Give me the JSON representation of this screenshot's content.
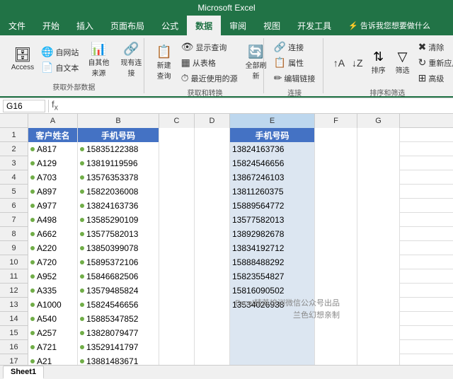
{
  "titleBar": {
    "text": "Microsoft Excel",
    "color": "#217346"
  },
  "ribbon": {
    "tabs": [
      "文件",
      "开始",
      "插入",
      "页面布局",
      "公式",
      "数据",
      "审阅",
      "视图",
      "开发工具",
      "告诉我您想要做什么"
    ],
    "activeTab": "数据",
    "groups": [
      {
        "label": "获取外部数据",
        "buttons": [
          {
            "id": "access",
            "label": "Access",
            "icon": "🗄"
          },
          {
            "id": "web",
            "label": "自网站",
            "icon": "🌐"
          },
          {
            "id": "text",
            "label": "自文本",
            "icon": "📄"
          },
          {
            "id": "other",
            "label": "自其他来源",
            "icon": "📊"
          },
          {
            "id": "existing",
            "label": "现有连接",
            "icon": "🔗"
          }
        ]
      },
      {
        "label": "获取和转换",
        "buttons": [
          {
            "id": "new-query",
            "label": "新建查询",
            "icon": "➕"
          },
          {
            "id": "show-query",
            "label": "显示查询",
            "icon": "👁"
          },
          {
            "id": "from-table",
            "label": "从表格",
            "icon": "▦"
          },
          {
            "id": "recent",
            "label": "最近使用的源",
            "icon": "⏱"
          },
          {
            "id": "refresh-all",
            "label": "全部刷新",
            "icon": "🔄"
          }
        ]
      },
      {
        "label": "连接",
        "buttons": [
          {
            "id": "connections",
            "label": "连接",
            "icon": "🔗"
          },
          {
            "id": "properties",
            "label": "属性",
            "icon": "📋"
          },
          {
            "id": "edit-links",
            "label": "编辑链接",
            "icon": "✏"
          }
        ]
      },
      {
        "label": "排序和筛选",
        "buttons": [
          {
            "id": "sort-asc",
            "label": "",
            "icon": "↑A"
          },
          {
            "id": "sort-desc",
            "label": "",
            "icon": "↓Z"
          },
          {
            "id": "sort",
            "label": "排序",
            "icon": "⇅"
          },
          {
            "id": "filter",
            "label": "筛选",
            "icon": "▽"
          },
          {
            "id": "clear",
            "label": "清除",
            "icon": "✖"
          },
          {
            "id": "reapply",
            "label": "重新应用",
            "icon": "↻"
          },
          {
            "id": "advanced",
            "label": "高级",
            "icon": "⊞"
          }
        ]
      }
    ],
    "accessLabel": "Access",
    "webLabel": "自网站",
    "textLabel": "自文本"
  },
  "formulaBar": {
    "cellRef": "G16",
    "formula": ""
  },
  "columns": [
    "A",
    "B",
    "C",
    "D",
    "E",
    "F",
    "G"
  ],
  "headers": {
    "row1": {
      "A": "客户姓名",
      "B": "手机号码",
      "E": "手机号码"
    }
  },
  "rows": [
    {
      "num": "2",
      "A": "A817",
      "B": "15835122388",
      "E": "13824163736"
    },
    {
      "num": "3",
      "A": "A129",
      "B": "13819119596",
      "E": "15824546656"
    },
    {
      "num": "4",
      "A": "A703",
      "B": "13576353378",
      "E": "13867246103"
    },
    {
      "num": "5",
      "A": "A897",
      "B": "15822036008",
      "E": "13811260375"
    },
    {
      "num": "6",
      "A": "A977",
      "B": "13824163736",
      "E": "15889564772"
    },
    {
      "num": "7",
      "A": "A498",
      "B": "13585290109",
      "E": "13577582013"
    },
    {
      "num": "8",
      "A": "A662",
      "B": "13577582013",
      "E": "13892982678"
    },
    {
      "num": "9",
      "A": "A220",
      "B": "13850399078",
      "E": "13834192712"
    },
    {
      "num": "10",
      "A": "A720",
      "B": "15895372106",
      "E": "15888488292"
    },
    {
      "num": "11",
      "A": "A952",
      "B": "15846682506",
      "E": "15823554827"
    },
    {
      "num": "12",
      "A": "A335",
      "B": "13579485824",
      "E": "15816090502"
    },
    {
      "num": "13",
      "A": "A1000",
      "B": "15824546656",
      "E": "13534026938"
    },
    {
      "num": "14",
      "A": "A540",
      "B": "15885347852",
      "E": ""
    },
    {
      "num": "15",
      "A": "A257",
      "B": "13828079477",
      "E": ""
    },
    {
      "num": "16",
      "A": "A721",
      "B": "13529141797",
      "E": ""
    },
    {
      "num": "17",
      "A": "A21",
      "B": "13881483671",
      "E": ""
    }
  ],
  "watermark": {
    "line1": "Excel精英培训微信公众号出品",
    "line2": "兰色幻想亲制"
  },
  "sheetTabs": [
    "Sheet1"
  ],
  "activeSheet": "Sheet1"
}
